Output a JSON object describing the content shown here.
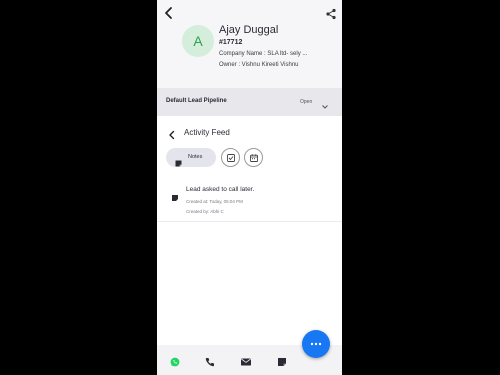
{
  "contact": {
    "avatar_initial": "A",
    "name": "Ajay Duggal",
    "id": "#17712",
    "company_line": "Company Name : SLA ltd- sely ...",
    "owner_line": "Owner : Vishnu Kireeti Vishnu"
  },
  "pipeline": {
    "name": "Default Lead Pipeline",
    "status": "Open"
  },
  "activity": {
    "title": "Activity Feed",
    "tabs": {
      "notes_label": "Notes"
    }
  },
  "feed": [
    {
      "text": "Lead asked to call later.",
      "created_at": "Created at: Today, 05:04 PM",
      "created_by": "Created by: Abhi C"
    }
  ],
  "colors": {
    "accent": "#1877f2",
    "avatar_bg": "#d5eedb",
    "avatar_text": "#2f9e4f",
    "whatsapp": "#25d366"
  },
  "icons": {
    "back": "arrow-left-icon",
    "share": "share-icon",
    "chevron": "chevron-down-icon",
    "notes": "note-icon",
    "task": "checkbox-icon",
    "meeting": "calendar-icon",
    "fab": "more-dots-icon",
    "nav": [
      "whatsapp-icon",
      "phone-icon",
      "email-icon",
      "note-icon"
    ]
  }
}
